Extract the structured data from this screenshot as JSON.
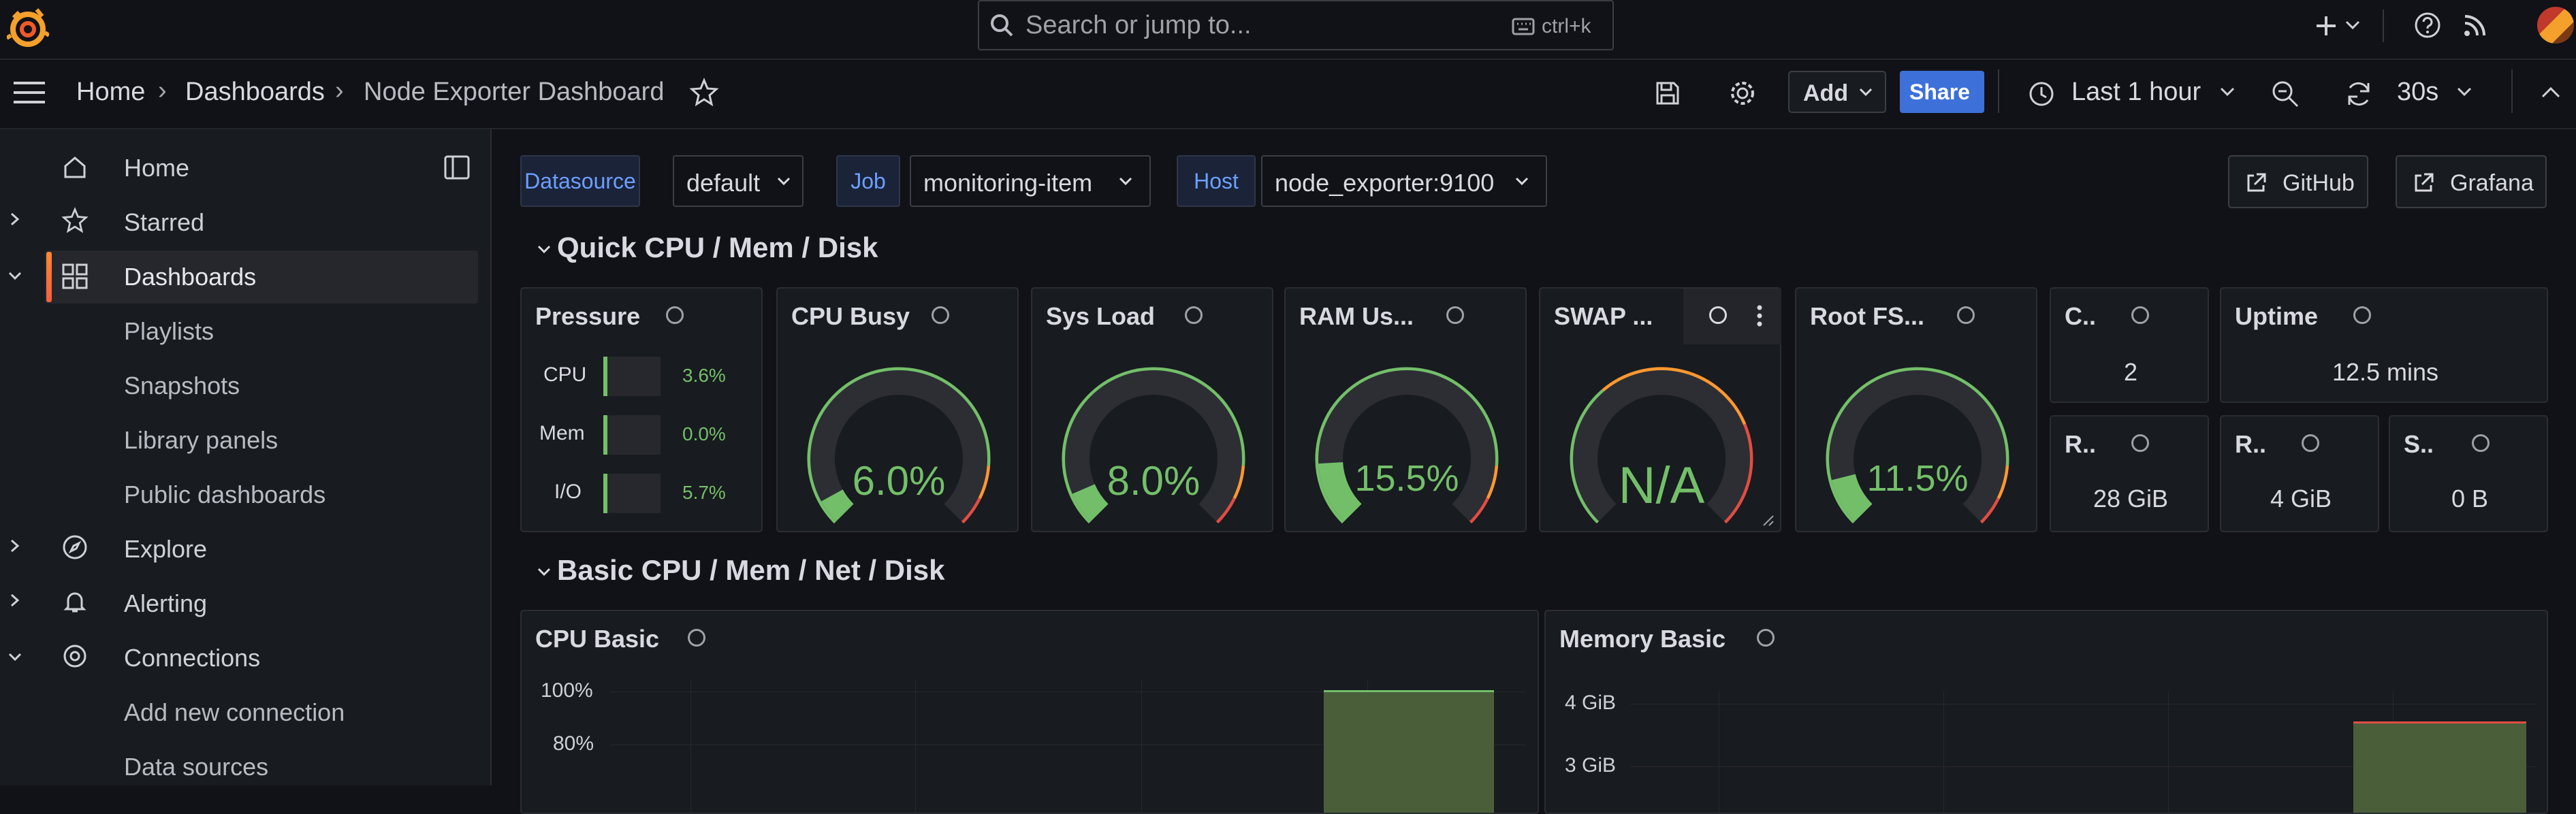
{
  "topbar": {
    "search_placeholder": "Search or jump to...",
    "search_shortcut": "ctrl+k"
  },
  "breadcrumbs": [
    "Home",
    "Dashboards",
    "Node Exporter Dashboard"
  ],
  "toolbar": {
    "add_label": "Add",
    "share_label": "Share",
    "time_range": "Last 1 hour",
    "refresh_interval": "30s"
  },
  "sidebar": {
    "items": [
      {
        "label": "Home"
      },
      {
        "label": "Starred"
      },
      {
        "label": "Dashboards"
      },
      {
        "label": "Playlists"
      },
      {
        "label": "Snapshots"
      },
      {
        "label": "Library panels"
      },
      {
        "label": "Public dashboards"
      },
      {
        "label": "Explore"
      },
      {
        "label": "Alerting"
      },
      {
        "label": "Connections"
      },
      {
        "label": "Add new connection"
      },
      {
        "label": "Data sources"
      }
    ]
  },
  "variables": {
    "datasource_label": "Datasource",
    "datasource_value": "default",
    "job_label": "Job",
    "job_value": "monitoring-item",
    "host_label": "Host",
    "host_value": "node_exporter:9100"
  },
  "links": {
    "github": "GitHub",
    "grafana": "Grafana"
  },
  "rows": {
    "row1": "Quick CPU / Mem / Disk",
    "row2": "Basic CPU / Mem / Net / Disk"
  },
  "panels": {
    "pressure": {
      "title": "Pressure",
      "rows": [
        {
          "label": "CPU",
          "value": "3.6%",
          "fraction": 0.036
        },
        {
          "label": "Mem",
          "value": "0.0%",
          "fraction": 0.0
        },
        {
          "label": "I/O",
          "value": "5.7%",
          "fraction": 0.057
        }
      ]
    },
    "cpu_busy": {
      "title": "CPU Busy",
      "value": "6.0%",
      "fraction": 0.06
    },
    "sys_load": {
      "title": "Sys Load",
      "value": "8.0%",
      "fraction": 0.08
    },
    "ram_used": {
      "title": "RAM Us...",
      "value": "15.5%",
      "fraction": 0.155
    },
    "swap_used": {
      "title": "SWAP ...",
      "value": "N/A"
    },
    "root_fs": {
      "title": "Root FS...",
      "value": "11.5%",
      "fraction": 0.115
    },
    "cpu_cores": {
      "title": "C..",
      "value": "2"
    },
    "uptime": {
      "title": "Uptime",
      "value": "12.5 mins"
    },
    "rootfs_total": {
      "title": "R..",
      "value": "28 GiB"
    },
    "ram_total": {
      "title": "R..",
      "value": "4 GiB"
    },
    "swap_total": {
      "title": "S..",
      "value": "0 B"
    },
    "cpu_basic": {
      "title": "CPU Basic",
      "y_ticks": [
        "100%",
        "80%"
      ]
    },
    "memory_basic": {
      "title": "Memory Basic",
      "y_ticks": [
        "4 GiB",
        "3 GiB"
      ]
    }
  },
  "colors": {
    "accent": "#f55f3e",
    "green": "#73bf69",
    "blue_button": "#3d71d9",
    "variable_label": "#6e9fff"
  }
}
